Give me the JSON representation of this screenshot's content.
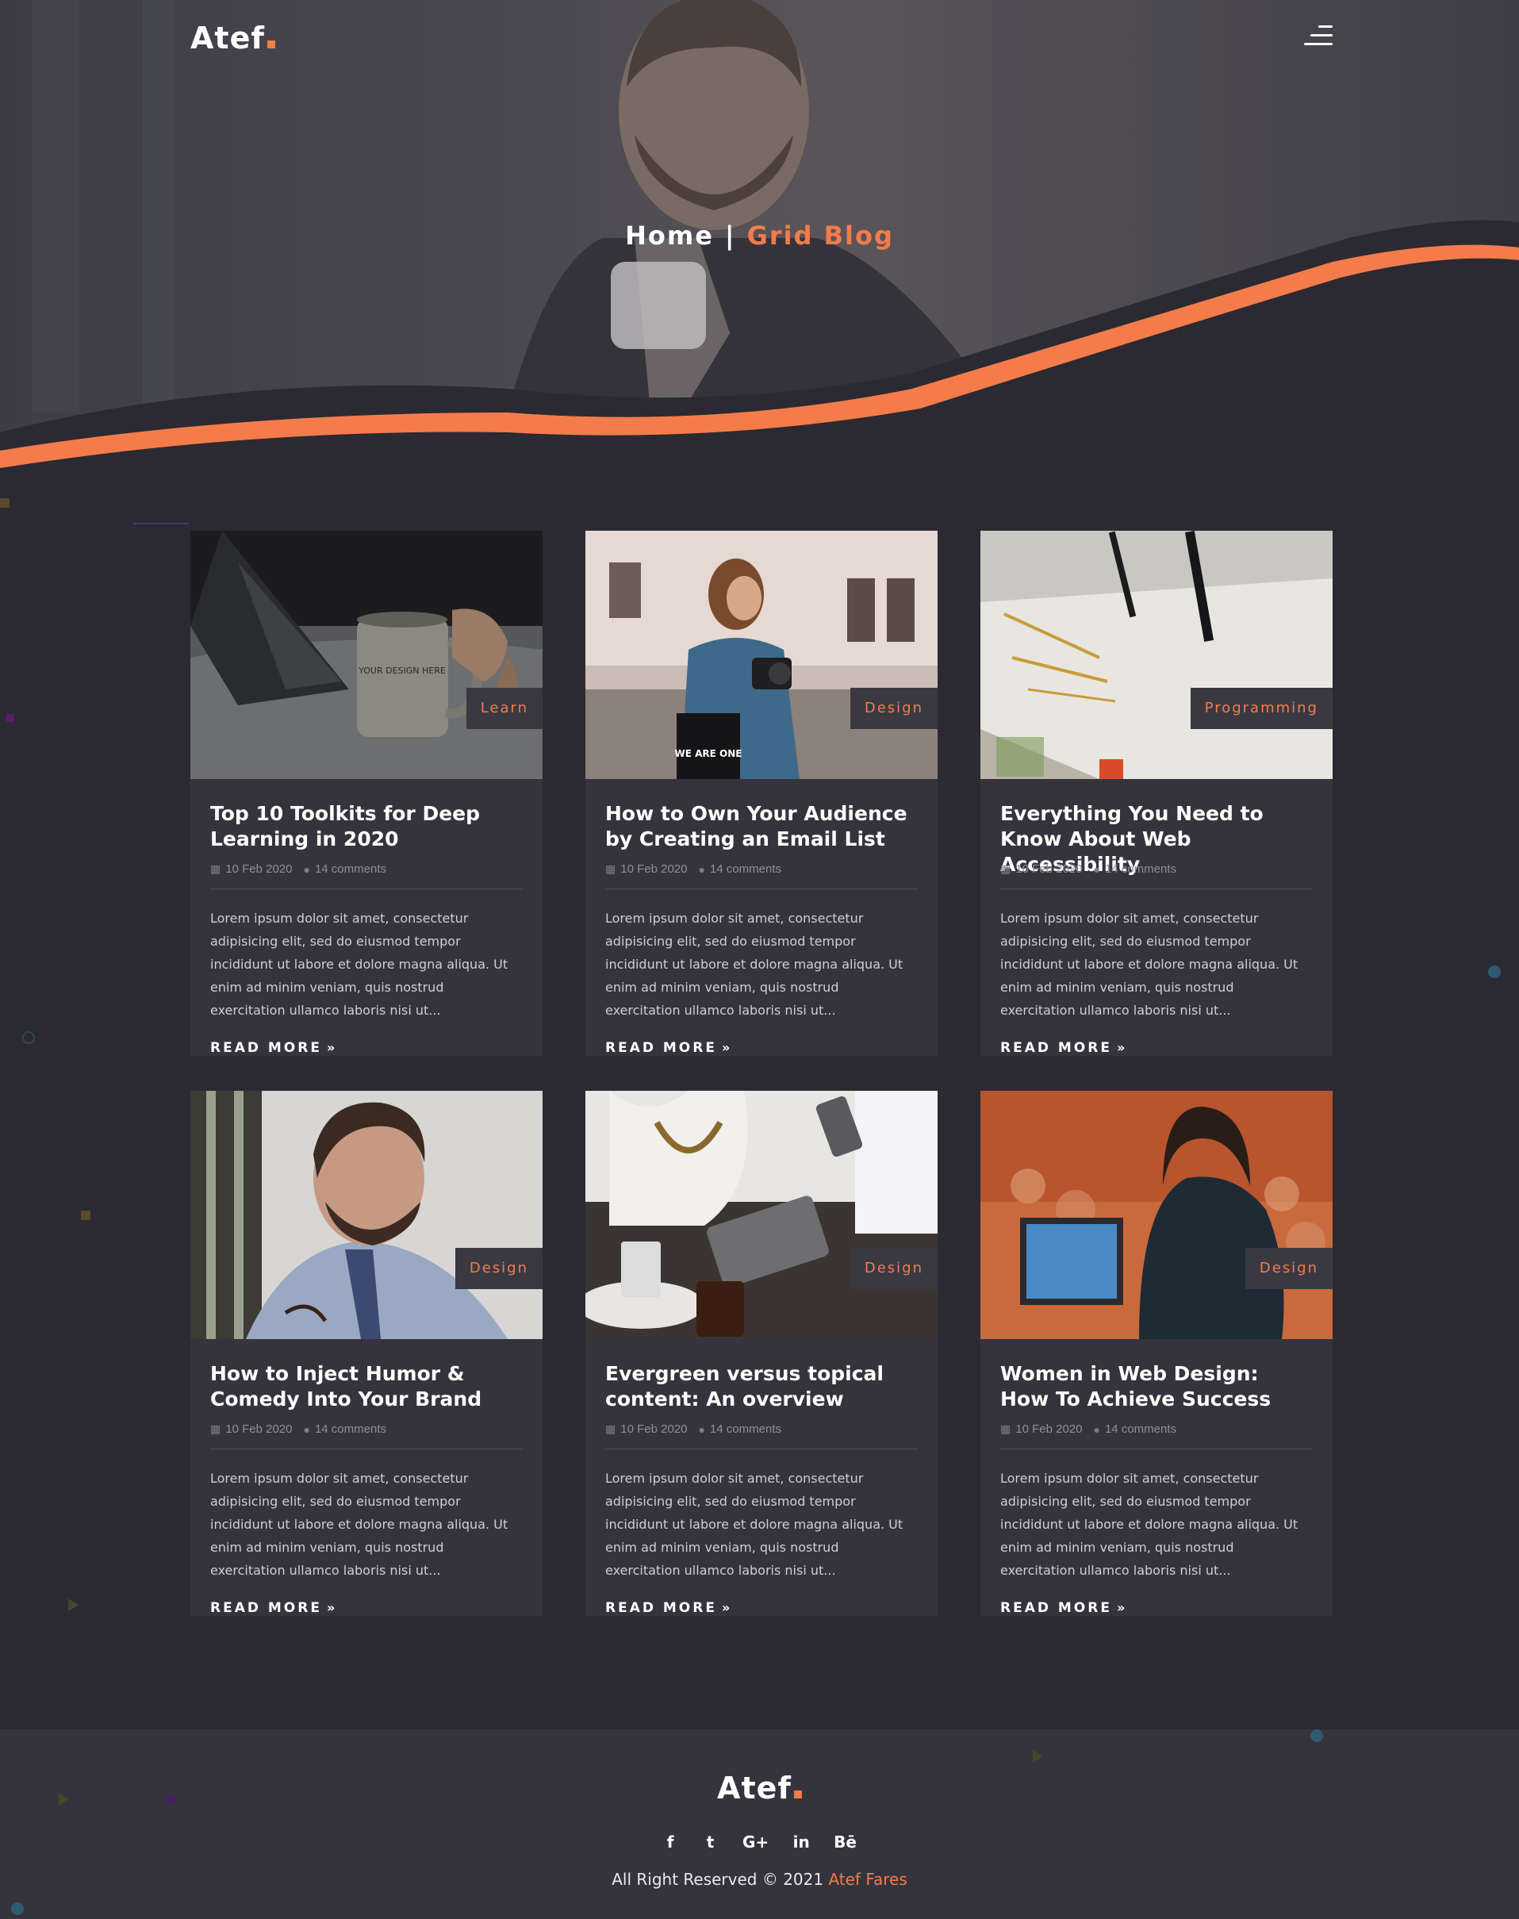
{
  "header": {
    "logo_text": "Atef",
    "breadcrumb_home": "Home",
    "breadcrumb_separator": "|",
    "breadcrumb_current": "Grid Blog"
  },
  "colors": {
    "accent": "#f47c4a",
    "background": "#2b2a32",
    "card": "#35343d"
  },
  "posts": [
    {
      "tag": "Learn",
      "title": "Top 10 Toolkits for Deep Learning in 2020",
      "date": "10 Feb 2020",
      "comments": "14 comments",
      "excerpt": "Lorem ipsum dolor sit amet, consectetur adipisicing elit, sed do eiusmod tempor incididunt ut labore et dolore magna aliqua. Ut enim ad minim veniam, quis nostrud exercitation ullamco laboris nisi ut...",
      "read_more": "READ MORE",
      "image_text": "YOUR DESIGN HERE"
    },
    {
      "tag": "Design",
      "title": "How to Own Your Audience by Creating an Email List",
      "date": "10 Feb 2020",
      "comments": "14 comments",
      "excerpt": "Lorem ipsum dolor sit amet, consectetur adipisicing elit, sed do eiusmod tempor incididunt ut labore et dolore magna aliqua. Ut enim ad minim veniam, quis nostrud exercitation ullamco laboris nisi ut...",
      "read_more": "READ MORE",
      "image_text": "WE ARE ONE"
    },
    {
      "tag": "Programming",
      "title": "Everything You Need to Know About Web Accessibility",
      "date": "10 Feb 2020",
      "comments": "14 comments",
      "excerpt": "Lorem ipsum dolor sit amet, consectetur adipisicing elit, sed do eiusmod tempor incididunt ut labore et dolore magna aliqua. Ut enim ad minim veniam, quis nostrud exercitation ullamco laboris nisi ut...",
      "read_more": "READ MORE"
    },
    {
      "tag": "Design",
      "title": "How to Inject Humor & Comedy Into Your Brand",
      "date": "10 Feb 2020",
      "comments": "14 comments",
      "excerpt": "Lorem ipsum dolor sit amet, consectetur adipisicing elit, sed do eiusmod tempor incididunt ut labore et dolore magna aliqua. Ut enim ad minim veniam, quis nostrud exercitation ullamco laboris nisi ut...",
      "read_more": "READ MORE"
    },
    {
      "tag": "Design",
      "title": "Evergreen versus topical content: An overview",
      "date": "10 Feb 2020",
      "comments": "14 comments",
      "excerpt": "Lorem ipsum dolor sit amet, consectetur adipisicing elit, sed do eiusmod tempor incididunt ut labore et dolore magna aliqua. Ut enim ad minim veniam, quis nostrud exercitation ullamco laboris nisi ut...",
      "read_more": "READ MORE"
    },
    {
      "tag": "Design",
      "title": "Women in Web Design: How To Achieve Success",
      "date": "10 Feb 2020",
      "comments": "14 comments",
      "excerpt": "Lorem ipsum dolor sit amet, consectetur adipisicing elit, sed do eiusmod tempor incididunt ut labore et dolore magna aliqua. Ut enim ad minim veniam, quis nostrud exercitation ullamco laboris nisi ut...",
      "read_more": "READ MORE"
    }
  ],
  "footer": {
    "logo_text": "Atef",
    "socials": [
      {
        "icon": "facebook-icon",
        "glyph": "f"
      },
      {
        "icon": "twitter-icon",
        "glyph": "t"
      },
      {
        "icon": "google-plus-icon",
        "glyph": "G+"
      },
      {
        "icon": "linkedin-icon",
        "glyph": "in"
      },
      {
        "icon": "behance-icon",
        "glyph": "Bē"
      }
    ],
    "copyright_text": "All Right Reserved © 2021",
    "author": "Atef Fares"
  }
}
